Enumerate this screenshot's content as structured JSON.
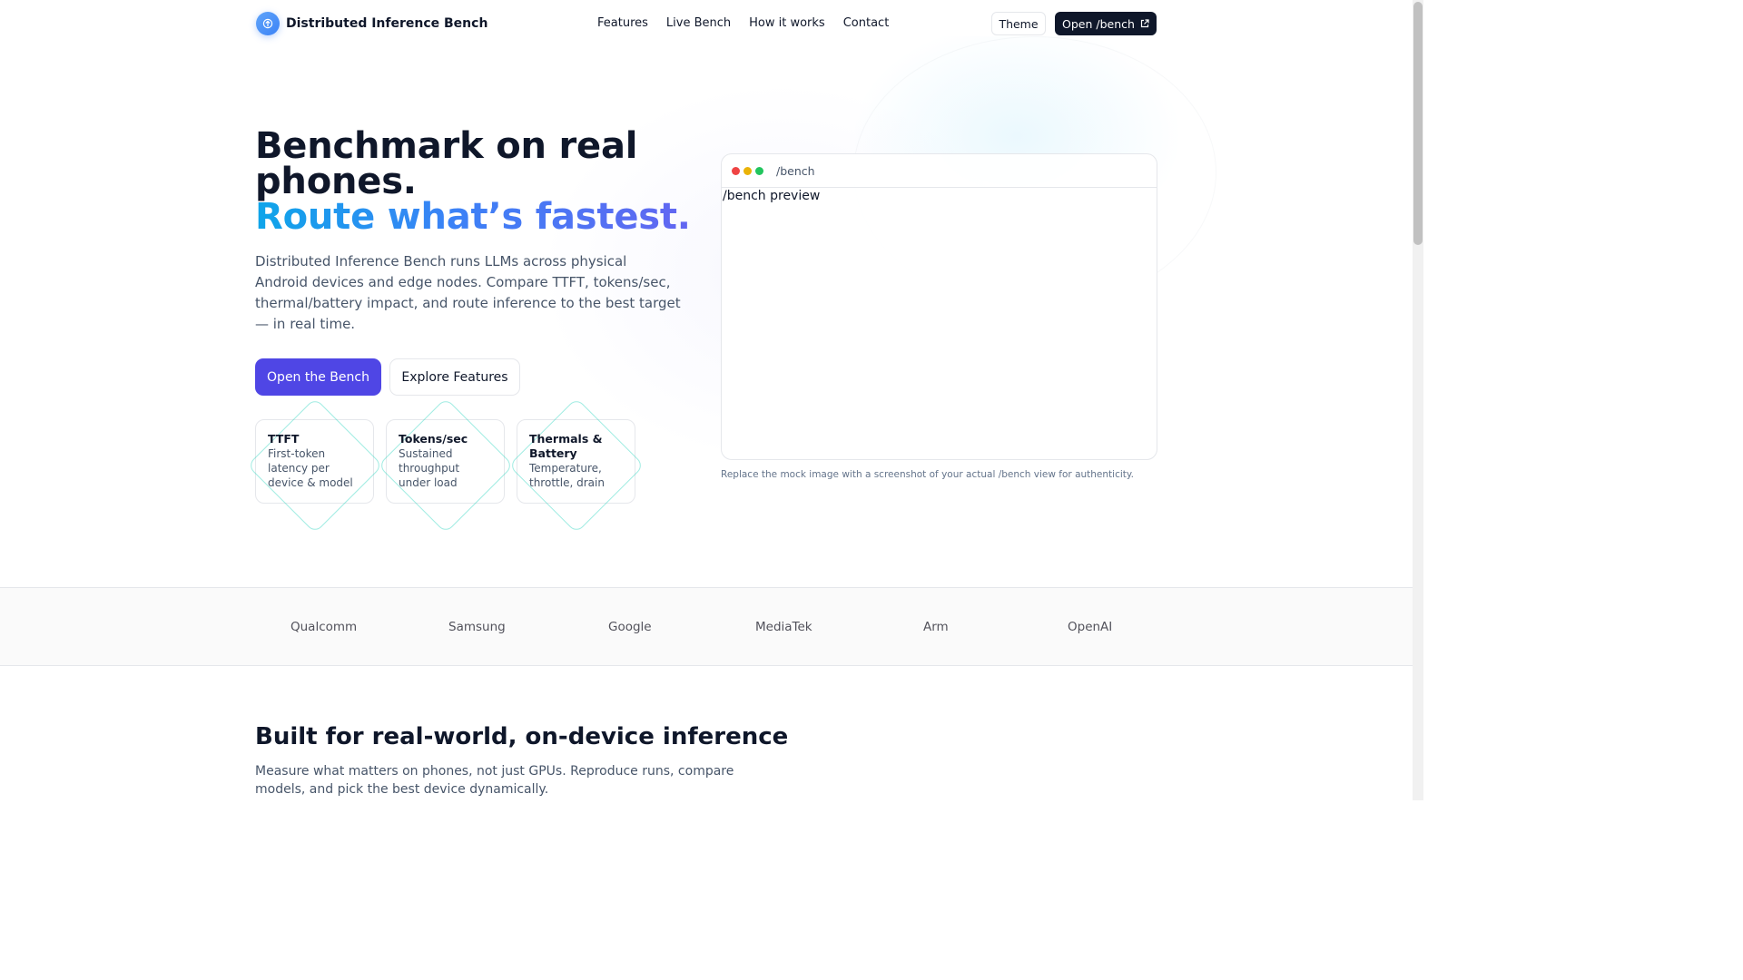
{
  "header": {
    "brand": "Distributed Inference Bench",
    "nav": [
      "Features",
      "Live Bench",
      "How it works",
      "Contact"
    ],
    "theme_label": "Theme",
    "open_label": "Open /bench"
  },
  "hero": {
    "title_line1": "Benchmark on real",
    "title_line2": "phones.",
    "title_accent": "Route what’s fastest.",
    "description": "Distributed Inference Bench runs LLMs across physical Android devices and edge nodes. Compare TTFT, tokens/sec, thermal/battery impact, and route inference to the best target — in real time.",
    "primary_cta": "Open the Bench",
    "secondary_cta": "Explore Features",
    "stats": [
      {
        "title": "TTFT",
        "sub": "First-token latency per device & model"
      },
      {
        "title": "Tokens/sec",
        "sub": "Sustained throughput under load"
      },
      {
        "title": "Thermals & Battery",
        "sub": "Temperature, throttle, drain"
      }
    ]
  },
  "preview": {
    "path": "/bench",
    "image_alt": "/bench preview",
    "note": "Replace the mock image with a screenshot of your actual /bench view for authenticity."
  },
  "logos": [
    "Qualcomm",
    "Samsung",
    "Google",
    "MediaTek",
    "Arm",
    "OpenAI"
  ],
  "section": {
    "title": "Built for real-world, on-device inference",
    "description": "Measure what matters on phones, not just GPUs. Reproduce runs, compare models, and pick the best device dynamically."
  },
  "colors": {
    "primary": "#4f46e5",
    "dark": "#0f172a",
    "accent_gradient_start": "#0ea5e9",
    "accent_gradient_end": "#6366f1",
    "dot_red": "#ef4444",
    "dot_yellow": "#eab308",
    "dot_green": "#22c55e"
  },
  "icons": {
    "brand_logo": "upload-arrow-circle-icon",
    "open_external": "external-link-icon",
    "broken_image": "broken-image-icon"
  }
}
